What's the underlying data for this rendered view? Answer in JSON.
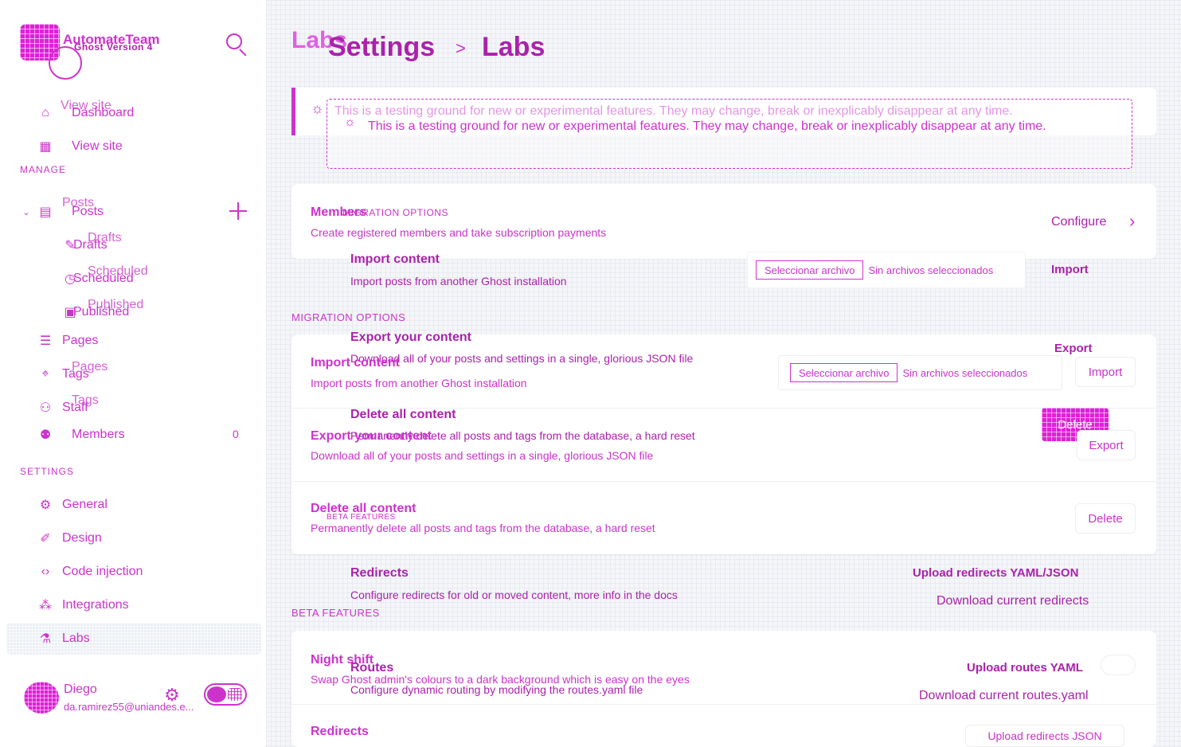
{
  "brand": {
    "name": "AutomateTeam",
    "version": "Ghost Version 4"
  },
  "sidebar": {
    "view_site_ghost": "View site",
    "dashboard": "Dashboard",
    "view_site": "View site",
    "manage_label": "MANAGE",
    "posts_ghost": "Posts",
    "posts": "Posts",
    "drafts_ghost": "Drafts",
    "drafts": "Drafts",
    "scheduled_ghost": "Scheduled",
    "scheduled": "Scheduled",
    "published_ghost": "Published",
    "published": "Published",
    "pages_ghost": "Pages",
    "tags_ghost": "Tags",
    "pages": "Pages",
    "staff_ghost": "Staff",
    "tags": "Tags",
    "members": "Members",
    "members_count": "0",
    "settings_label": "SETTINGS",
    "general": "General",
    "design": "Design",
    "code_injection": "Code injection",
    "integrations": "Integrations",
    "labs": "Labs"
  },
  "user": {
    "name": "Diego",
    "email": "da.ramirez55@uniandes.e..."
  },
  "header": {
    "ghost_title": "Labs",
    "settings": "Settings",
    "separator": ">",
    "current": "Labs"
  },
  "banner": {
    "ghost_text": "This is a testing ground for new or experimental features. They may change, break or inexplicably disappear at any time.",
    "text": "This is a testing ground for new or experimental features. They may change, break or inexplicably disappear at any time."
  },
  "members_card": {
    "title": "Members",
    "mini_label": "MIGRATION OPTIONS",
    "desc": "Create registered members and take subscription payments",
    "configure": "Configure"
  },
  "import_ghost": {
    "title": "Import content",
    "desc": "Import posts from another Ghost installation",
    "file_button": "Seleccionar archivo",
    "file_status": "Sin archivos seleccionados",
    "import": "Import"
  },
  "migration_label": "MIGRATION OPTIONS",
  "export_ghost": {
    "title": "Export your content",
    "desc": "Download all of your posts and settings in a single, glorious JSON file",
    "export": "Export"
  },
  "import_row": {
    "title": "Import content",
    "desc": "Import posts from another Ghost installation",
    "file_button": "Seleccionar archivo",
    "file_status": "Sin archivos seleccionados",
    "import": "Import"
  },
  "delete_ghost": {
    "title": "Delete all content",
    "desc": "Permanently delete all posts and tags from the database, a hard reset",
    "delete": "Delete"
  },
  "export_row": {
    "title": "Export your content",
    "desc": "Download all of your posts and settings in a single, glorious JSON file",
    "export": "Export"
  },
  "delete_row": {
    "title": "Delete all content",
    "mini_label": "BETA FEATURES",
    "desc": "Permanently delete all posts and tags from the database, a hard reset",
    "delete": "Delete"
  },
  "redirects_ghost": {
    "title": "Redirects",
    "desc": "Configure redirects for old or moved content, more info in the docs",
    "upload": "Upload redirects YAML/JSON",
    "download": "Download current redirects"
  },
  "beta_label": "BETA FEATURES",
  "night_shift": {
    "title": "Night shift",
    "desc": "Swap Ghost admin's colours to a dark background which is easy on the eyes"
  },
  "routes_ghost": {
    "title": "Routes",
    "desc": "Configure dynamic routing by modifying the routes.yaml file",
    "upload": "Upload routes YAML",
    "download": "Download current routes.yaml"
  },
  "redirects_row": {
    "title": "Redirects",
    "upload": "Upload redirects JSON"
  },
  "colors": {
    "accent": "#cc33cc",
    "sidebar_bg": "#ffffff",
    "main_bg": "#f5f6f9",
    "active_bg": "#eceff4"
  }
}
